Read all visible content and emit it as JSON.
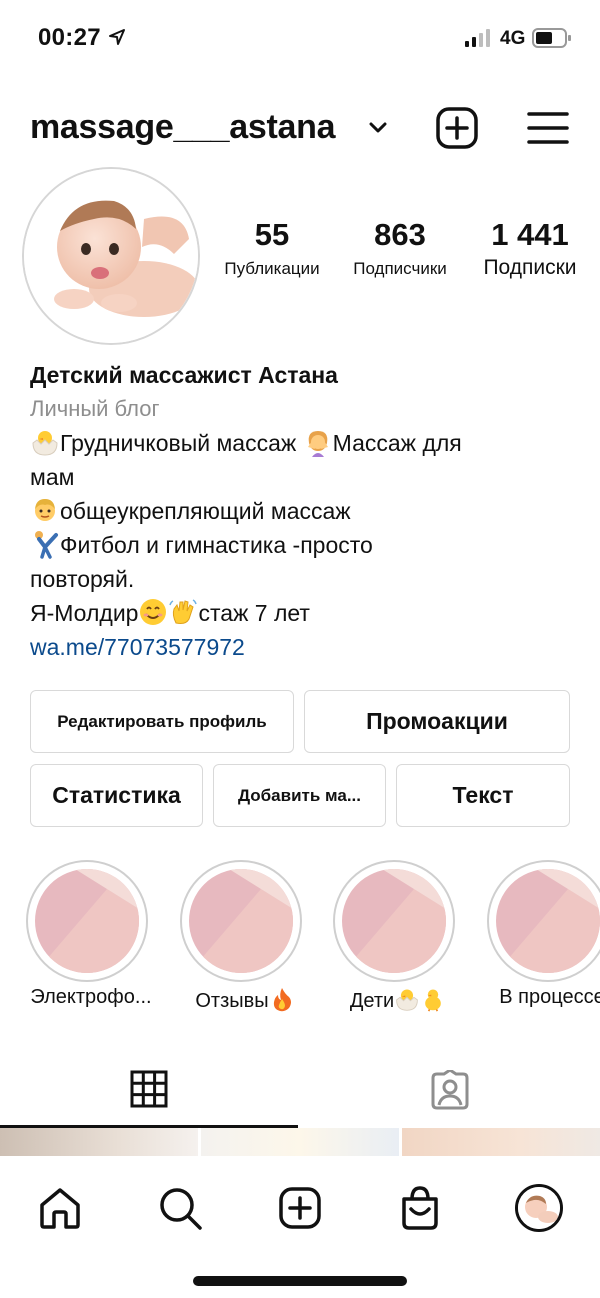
{
  "status_bar": {
    "time": "00:27",
    "network": "4G"
  },
  "header": {
    "username": "massage___astana"
  },
  "stats": {
    "posts": {
      "value": "55",
      "label": "Публикации"
    },
    "followers": {
      "value": "863",
      "label": "Подписчики"
    },
    "following": {
      "value": "1 441",
      "label": "Подписки"
    }
  },
  "bio": {
    "name": "Детский массажист Астана",
    "category": "Личный блог",
    "line1a": "Грудничковый массаж ",
    "line1b": "Массаж для",
    "line2": "мам",
    "line3": "общеукрепляющий массаж",
    "line4": "Фитбол и гимнастика -просто",
    "line5": "повторяй.",
    "line6a": "Я-Молдир",
    "line6b": "стаж 7 лет",
    "link": "wa.me/77073577972"
  },
  "buttons": {
    "edit_profile": "Редактировать профиль",
    "promotions": "Промоакции",
    "insights": "Статистика",
    "add_payment": "Добавить ма...",
    "text": "Текст"
  },
  "highlights": [
    {
      "label": "Электрофо..."
    },
    {
      "label": "Отзывы"
    },
    {
      "label": "Дети"
    },
    {
      "label": "В процессе"
    }
  ],
  "icons": {
    "status": [
      "location-arrow-icon",
      "signal-icon",
      "battery-icon"
    ],
    "header": [
      "chevron-down-icon",
      "new-post-icon",
      "menu-icon"
    ],
    "tabs": [
      "grid-icon",
      "tagged-icon"
    ],
    "nav": [
      "home-icon",
      "search-icon",
      "create-icon",
      "shop-icon",
      "profile-avatar"
    ]
  },
  "colors": {
    "link": "#0b4a8c",
    "muted": "#8e8e8e",
    "border": "#d9d9d9",
    "highlight_pink": "#ecc2c6"
  }
}
